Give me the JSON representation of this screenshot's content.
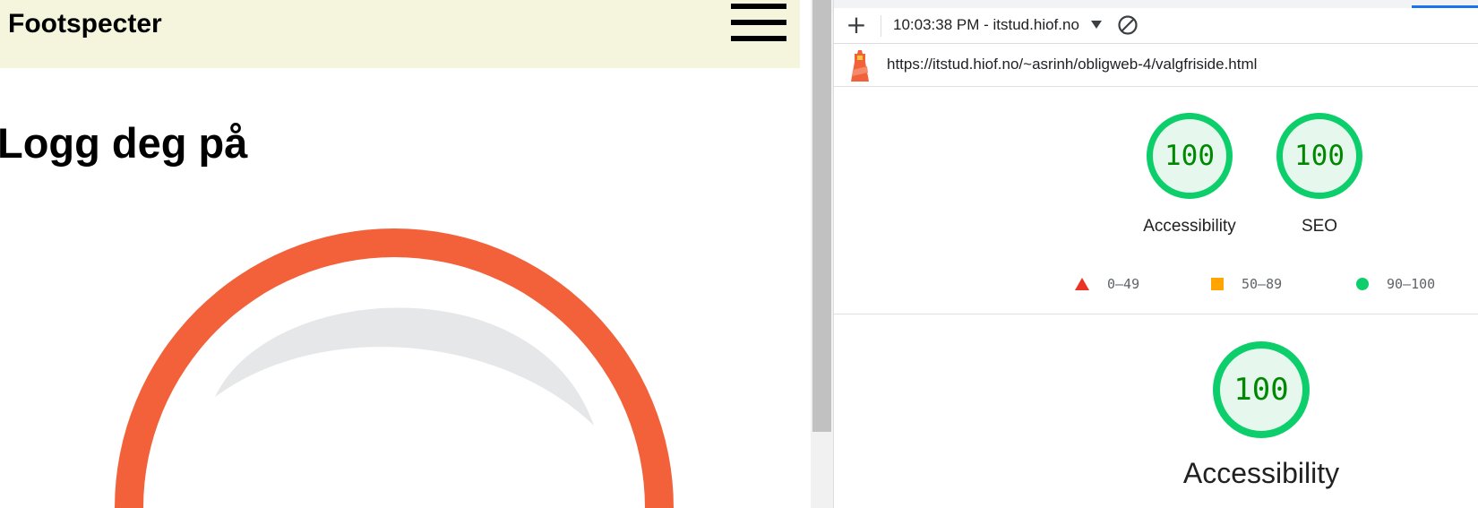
{
  "site": {
    "brand": "Footspecter",
    "heading": "Logg deg på",
    "colors": {
      "header_bg": "#f5f4dd",
      "illustration_ring": "#f2613a",
      "illustration_shine": "#e6e7e9"
    }
  },
  "lighthouse": {
    "toolbar": {
      "new_report_icon": "plus-icon",
      "report_label": "10:03:38 PM - itstud.hiof.no",
      "clear_icon": "block-icon"
    },
    "url": "https://itstud.hiof.no/~asrinh/obligweb-4/valgfriside.html",
    "summary_gauges": [
      {
        "label": "Accessibility",
        "score": "100"
      },
      {
        "label": "SEO",
        "score": "100"
      }
    ],
    "legend": [
      {
        "range": "0–49",
        "icon": "triangle-icon",
        "color": "#eb3324"
      },
      {
        "range": "50–89",
        "icon": "square-icon",
        "color": "#ffa400"
      },
      {
        "range": "90–100",
        "icon": "circle-icon",
        "color": "#0cce6b"
      }
    ],
    "category": {
      "label": "Accessibility",
      "score": "100"
    },
    "colors": {
      "pass": "#0cce6b",
      "pass_text": "#008800",
      "pass_bg": "#e6f8ee"
    }
  }
}
